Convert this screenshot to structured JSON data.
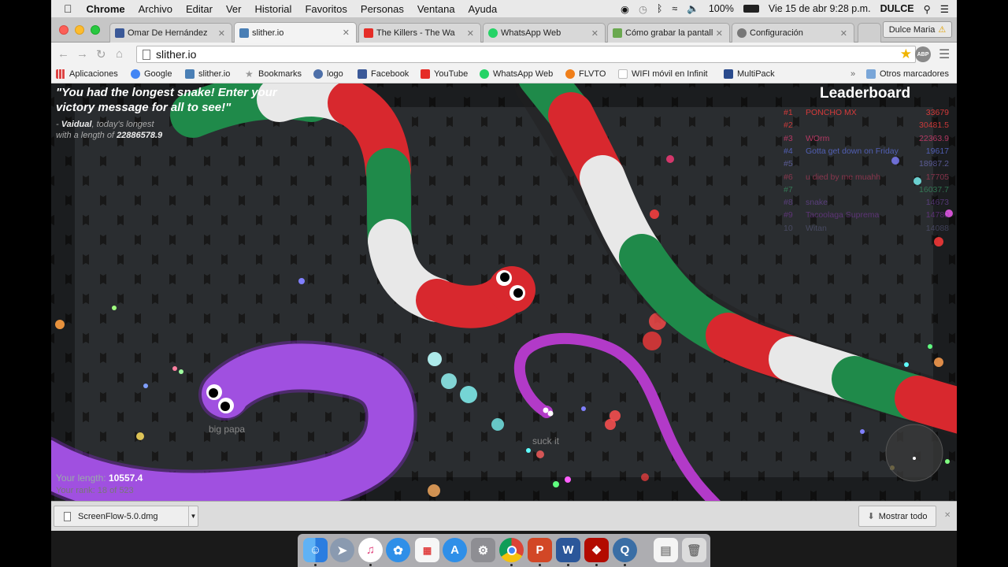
{
  "menubar": {
    "items": [
      "Chrome",
      "Archivo",
      "Editar",
      "Ver",
      "Historial",
      "Favoritos",
      "Personas",
      "Ventana",
      "Ayuda"
    ],
    "battery": "100%",
    "datetime": "Vie 15 de abr  9:28 p.m.",
    "user": "DULCE"
  },
  "tabs": [
    {
      "label": "Omar De Hernández",
      "icon_color": "#3b5998"
    },
    {
      "label": "slither.io",
      "icon_color": "#4a7fb5",
      "active": true
    },
    {
      "label": "The Killers - The Wa",
      "icon_color": "#e52d27"
    },
    {
      "label": "WhatsApp Web",
      "icon_color": "#25d366"
    },
    {
      "label": "Cómo grabar la pantall",
      "icon_color": "#6aa84f"
    },
    {
      "label": "Configuración",
      "icon_color": "#777777"
    }
  ],
  "profile": {
    "name": "Dulce Maria"
  },
  "omnibox": {
    "url": "slither.io"
  },
  "bookmarks": [
    {
      "label": "Aplicaciones",
      "icon_color": "#d44"
    },
    {
      "label": "Google",
      "icon_color": "#4285f4"
    },
    {
      "label": "slither.io",
      "icon_color": "#4a7fb5"
    },
    {
      "label": "Bookmarks",
      "icon_color": "#999999"
    },
    {
      "label": "logo",
      "icon_color": "#4d6fa8"
    },
    {
      "label": "Facebook",
      "icon_color": "#3b5998"
    },
    {
      "label": "YouTube",
      "icon_color": "#e52d27"
    },
    {
      "label": "WhatsApp Web",
      "icon_color": "#25d366"
    },
    {
      "label": "FLVTO",
      "icon_color": "#f07f1a"
    },
    {
      "label": "WIFI móvil en Infinit",
      "icon_color": "#cccccc"
    },
    {
      "label": "MultiPack",
      "icon_color": "#2a4b8d"
    }
  ],
  "other_bookmarks": "Otros marcadores",
  "game": {
    "victory_message": "\"You had the longest snake! Enter your victory message for all to see!\"",
    "author_prefix": "- ",
    "author": "Vaidual",
    "author_suffix": ", today's longest",
    "length_prefix": "with a length of ",
    "length_value": "22886578.9",
    "leaderboard_title": "Leaderboard",
    "leaderboard": [
      {
        "rank": "#1",
        "name": "PONCHO MX",
        "score": "33679",
        "color": "#d43a3a"
      },
      {
        "rank": "#2",
        "name": "",
        "score": "30481.5",
        "color": "#d43a3a"
      },
      {
        "rank": "#3",
        "name": "WOrm",
        "score": "22363.9",
        "color": "#c63a6a"
      },
      {
        "rank": "#4",
        "name": "Gotta get down on Friday",
        "score": "19617",
        "color": "#5a6ad0"
      },
      {
        "rank": "#5",
        "name": "",
        "score": "18987.2",
        "color": "#6a6ab5"
      },
      {
        "rank": "#6",
        "name": "u died by me muahh",
        "score": "17705",
        "color": "#b03a5a"
      },
      {
        "rank": "#7",
        "name": "",
        "score": "16037.7",
        "color": "#3aa26a"
      },
      {
        "rank": "#8",
        "name": "snake",
        "score": "14673",
        "color": "#7a4ab0"
      },
      {
        "rank": "#9",
        "name": "Tacoolaga Suprema",
        "score": "14780",
        "color": "#8a3ab5"
      },
      {
        "rank": "10",
        "name": "Witan",
        "score": "14088",
        "color": "#6a6a9a"
      }
    ],
    "your_length_label": "Your length: ",
    "your_length_value": "10557.4",
    "your_rank": "Your rank: 18 of 523",
    "nick_big_papa": "big papa",
    "nick_suck_it": "suck it",
    "player_color": "#a050e0",
    "enemy_color": "#b23ac8"
  },
  "downloads": {
    "file": "ScreenFlow-5.0.dmg",
    "show_all": "Mostrar todo"
  },
  "dock": {
    "icons": [
      "finder-icon",
      "launchpad-icon",
      "itunes-icon",
      "safari-icon",
      "calculator-icon",
      "app-store-icon",
      "system-preferences-icon",
      "chrome-icon",
      "powerpoint-icon",
      "word-icon",
      "acrobat-icon",
      "quicktime-icon",
      "document-icon",
      "trash-icon"
    ]
  }
}
